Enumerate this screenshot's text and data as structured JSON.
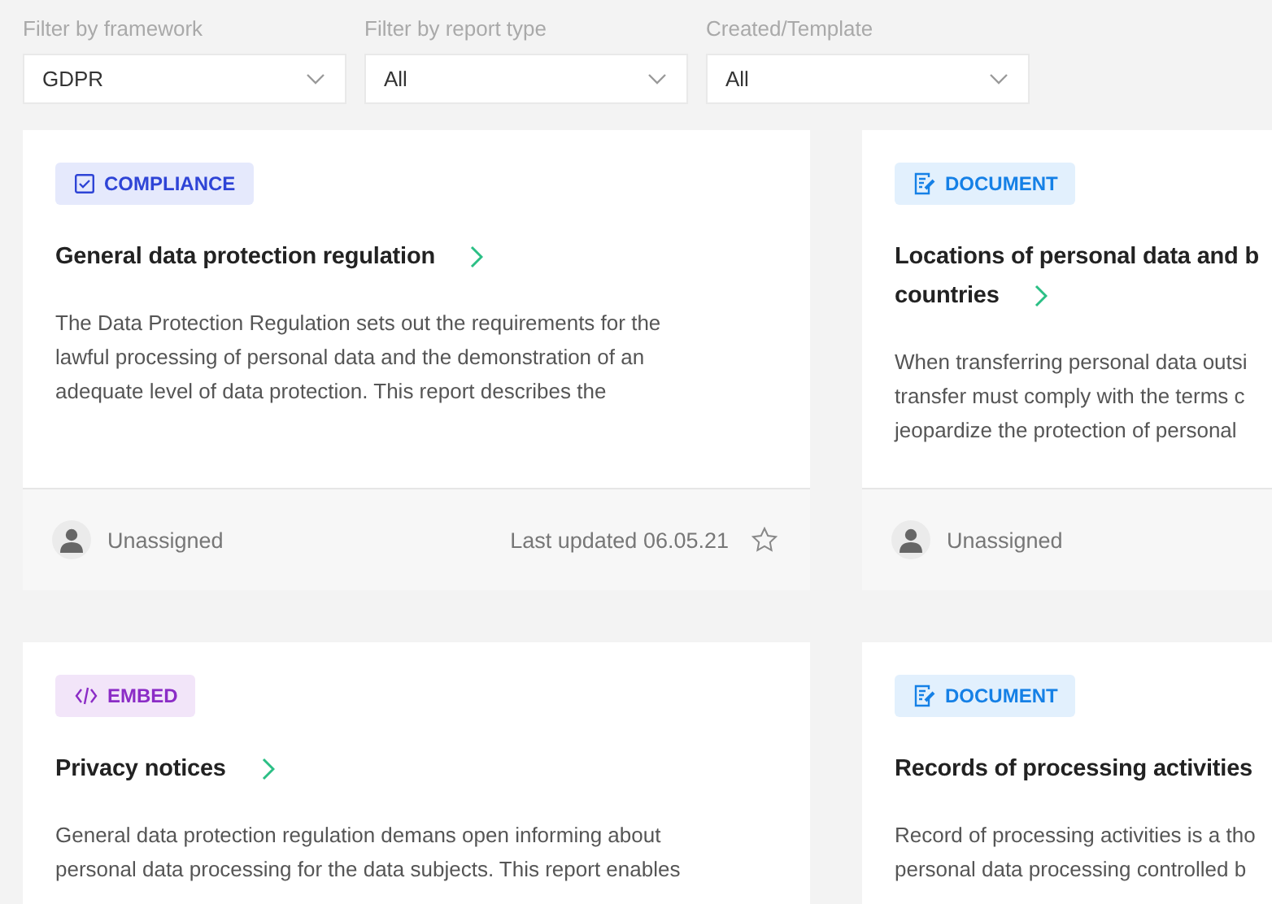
{
  "filters": [
    {
      "label": "Filter by framework",
      "value": "GDPR"
    },
    {
      "label": "Filter by report type",
      "value": "All"
    },
    {
      "label": "Created/Template",
      "value": "All"
    }
  ],
  "cards": [
    {
      "tag": {
        "kind": "compliance",
        "label": "COMPLIANCE"
      },
      "title_lines": [
        "General data protection regulation"
      ],
      "description_lines": [
        "The Data Protection Regulation sets out the requirements for the",
        "lawful processing of personal data and the demonstration of an",
        "adequate level of data protection. This report describes the"
      ],
      "footer": {
        "assignee": "Unassigned",
        "updated": "Last updated 06.05.21",
        "starred": false
      }
    },
    {
      "tag": {
        "kind": "document",
        "label": "DOCUMENT"
      },
      "title_lines": [
        "Locations of personal data and b",
        "countries"
      ],
      "description_lines": [
        "When transferring personal data outsi",
        "transfer must comply with the terms c",
        "jeopardize the protection of personal"
      ],
      "footer": {
        "assignee": "Unassigned"
      }
    },
    {
      "tag": {
        "kind": "embed",
        "label": "EMBED"
      },
      "title_lines": [
        "Privacy notices"
      ],
      "description_lines": [
        "General data protection regulation demans open informing about",
        "personal data processing for the data subjects. This report enables"
      ]
    },
    {
      "tag": {
        "kind": "document",
        "label": "DOCUMENT"
      },
      "title_lines": [
        "Records of processing activities"
      ],
      "description_lines": [
        "Record of processing activities is a tho",
        "personal data processing controlled b"
      ]
    }
  ]
}
